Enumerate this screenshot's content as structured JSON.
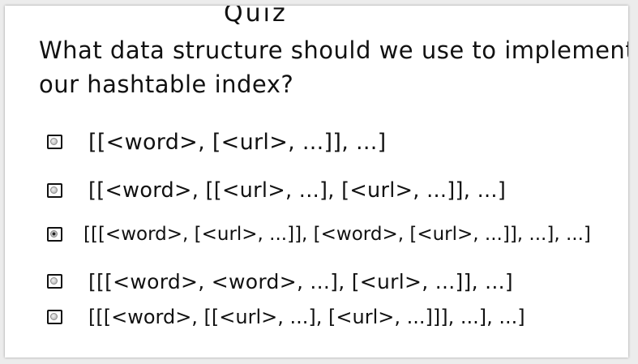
{
  "quiz": {
    "title": "Quiz",
    "question_line1": "What data structure should we use to implement",
    "question_line2": "our hashtable index?",
    "options": [
      {
        "label": "[[<word>, [<url>, ...]], ...]",
        "selected": false
      },
      {
        "label": "[[<word>, [[<url>, ...], [<url>, ...]], ...]",
        "selected": false
      },
      {
        "label": "[[[<word>, [<url>, ...]], [<word>, [<url>, ...]], ...], ...]",
        "selected": true
      },
      {
        "label": "[[[<word>, <word>, ...], [<url>, ...]], ...]",
        "selected": false
      },
      {
        "label": "[[[<word>, [[<url>, ...], [<url>, ...]]], ...], ...]",
        "selected": false
      }
    ]
  }
}
